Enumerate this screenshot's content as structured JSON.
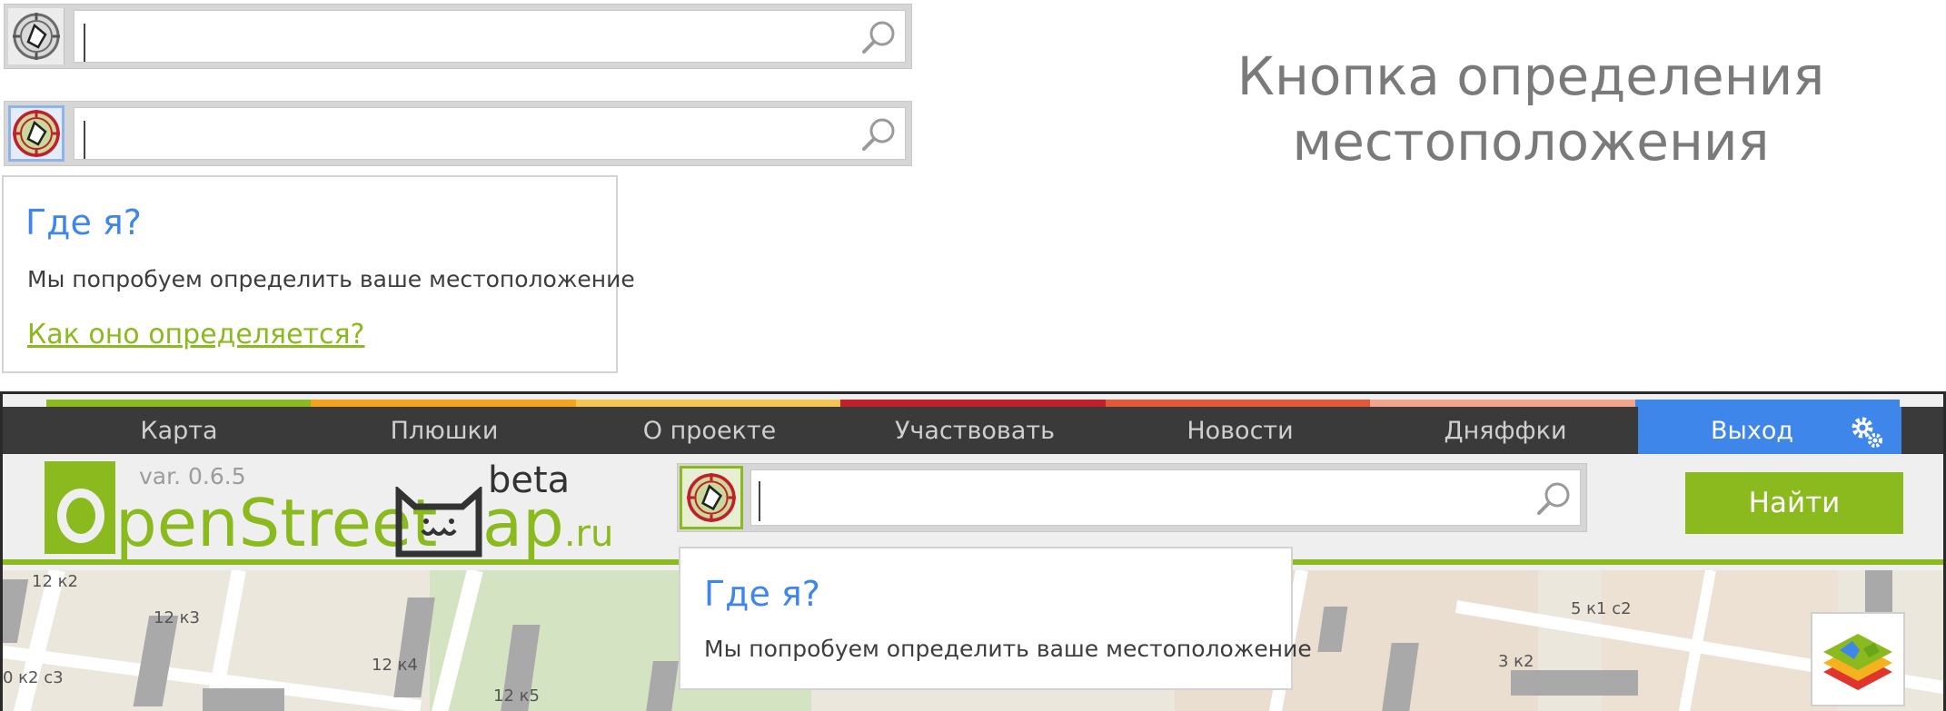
{
  "heading": {
    "line1": "Кнопка определения",
    "line2": "местоположения"
  },
  "popup_top": {
    "title": "Где я?",
    "text": "Мы попробуем определить ваше местоположение",
    "link": "Как оно определяется?"
  },
  "nav": {
    "items": [
      "Карта",
      "Плюшки",
      "О проекте",
      "Участвовать",
      "Новости",
      "Дняффки"
    ],
    "exit": "Выход",
    "strip_colors": [
      "#8bba1e",
      "#f3a31d",
      "#f5c451",
      "#c0202b",
      "#e05a3a",
      "#f2a58a"
    ]
  },
  "logo": {
    "version": "var. 0.6.5",
    "beta": "beta",
    "text_open": "penStreet",
    "text_map": "ap",
    "suffix": ".ru"
  },
  "search": {
    "find_label": "Найти"
  },
  "popup_bottom": {
    "title": "Где я?",
    "text": "Мы попробуем определить ваше местоположение"
  },
  "map": {
    "labels": [
      "12 к2",
      "12 к3",
      "12 к4",
      "12 к5",
      "0 к2 с3",
      "5 к1 с2",
      "3 к2"
    ]
  },
  "colors": {
    "accent_blue": "#3f86ea",
    "accent_green": "#8bba1e"
  },
  "icons": {
    "locate": "locate-target-icon",
    "search": "magnifier-icon",
    "settings": "gear-icon",
    "layers": "map-layers-icon"
  }
}
